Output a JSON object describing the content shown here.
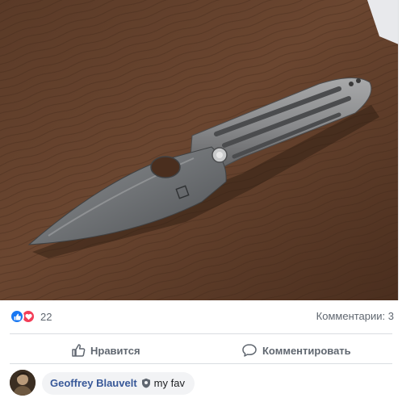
{
  "reactions": {
    "count": "22",
    "icons": [
      "like-icon",
      "love-icon"
    ],
    "colors": {
      "like": "#1877f2",
      "love": "#f33e58"
    }
  },
  "comments_summary": "Комментарии: 3",
  "actions": {
    "like_label": "Нравится",
    "comment_label": "Комментировать"
  },
  "comment": {
    "author": "Geoffrey Blauvelt",
    "badge_icon": "shield-badge-icon",
    "text": "my fav"
  },
  "photo": {
    "subject": "knife-photo"
  }
}
